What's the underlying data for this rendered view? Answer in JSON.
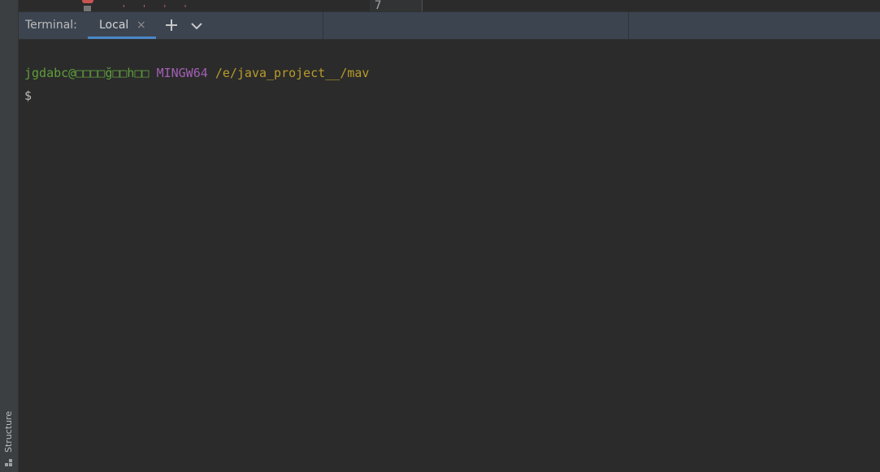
{
  "editor": {
    "line_number": "7"
  },
  "terminal": {
    "title": "Terminal:",
    "tabs": [
      {
        "label": "Local",
        "active": true
      }
    ],
    "close_glyph": "×",
    "add_glyph": "+",
    "prompt": {
      "user_host": "jgdabc@□□□□ğ□□h□□",
      "system": "MINGW64",
      "path": "/e/java_project__/mav",
      "symbol": "$"
    }
  },
  "left_toolbar": {
    "structure_label": "Structure"
  },
  "colors": {
    "background": "#2b2b2b",
    "header": "#3c4450",
    "user_green": "#5f9e3c",
    "system_purple": "#a25fb5",
    "path_yellow": "#b99b2a",
    "tab_underline": "#4a88c7"
  },
  "icons": {
    "add": "plus-icon",
    "dropdown": "chevron-down-icon",
    "close": "close-icon",
    "structure": "structure-icon"
  }
}
